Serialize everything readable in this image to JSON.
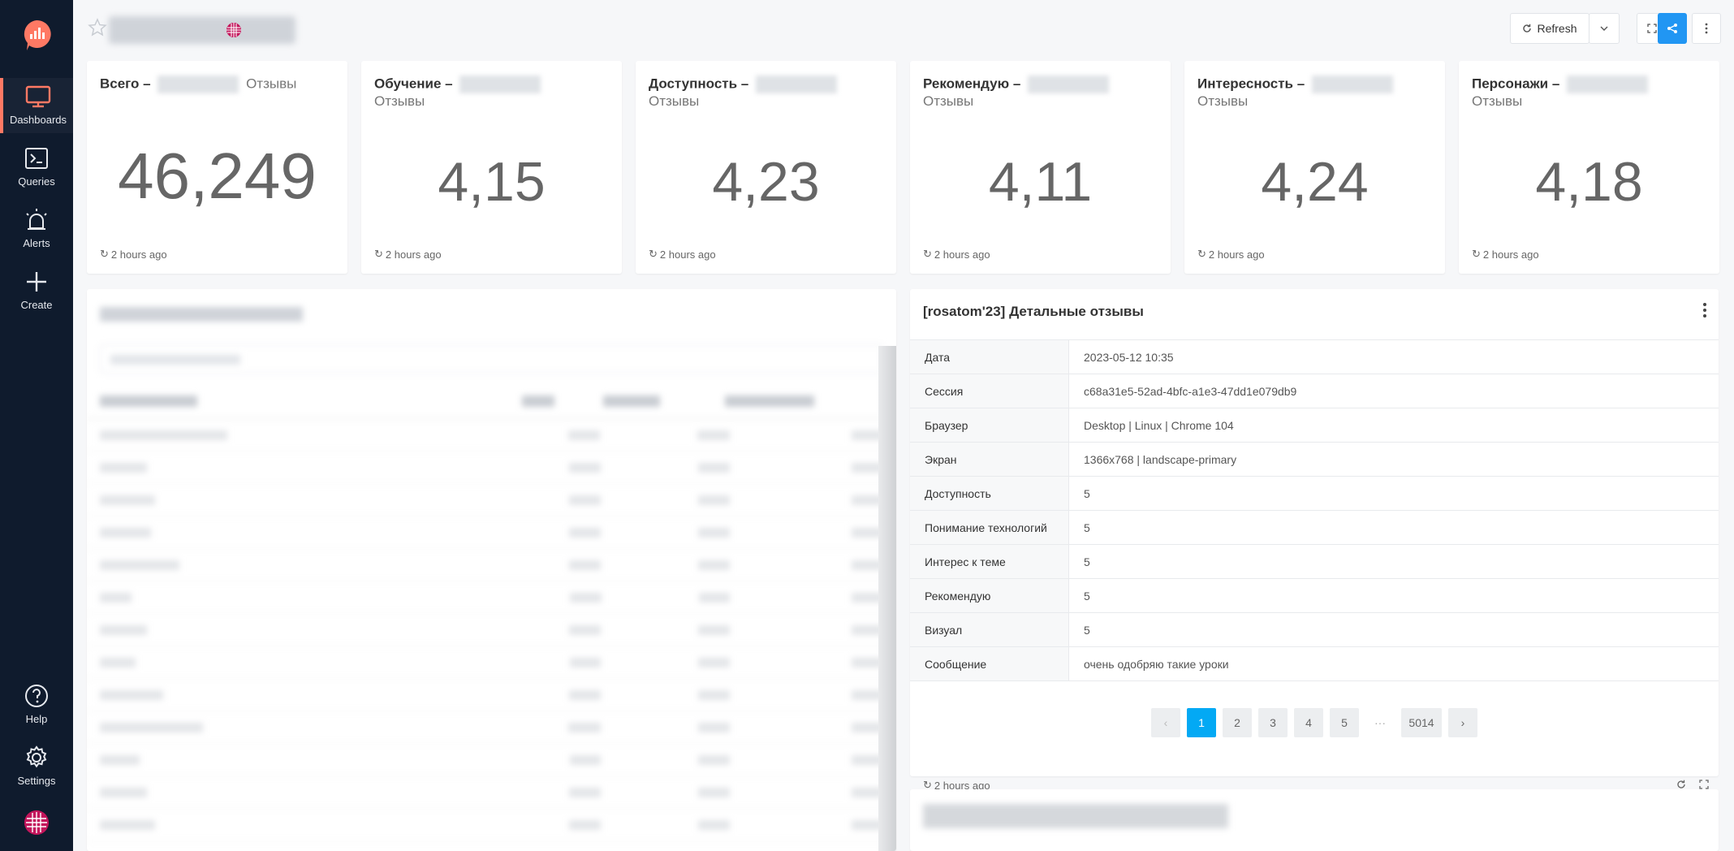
{
  "sidebar": {
    "items": [
      {
        "label": "Dashboards"
      },
      {
        "label": "Queries"
      },
      {
        "label": "Alerts"
      },
      {
        "label": "Create"
      },
      {
        "label": "Help"
      },
      {
        "label": "Settings"
      }
    ],
    "accent": "#ff7964"
  },
  "header": {
    "refresh_label": "Refresh"
  },
  "counters": [
    {
      "title": "Всего",
      "subtitle": "Отзывы",
      "value": "46,249",
      "updated": "2 hours ago"
    },
    {
      "title": "Обучение",
      "subtitle": "Отзывы",
      "value": "4,15",
      "updated": "2 hours ago"
    },
    {
      "title": "Доступность",
      "subtitle": "Отзывы",
      "value": "4,23",
      "updated": "2 hours ago"
    },
    {
      "title": "Рекомендую",
      "subtitle": "Отзывы",
      "value": "4,11",
      "updated": "2 hours ago"
    },
    {
      "title": "Интересность",
      "subtitle": "Отзывы",
      "value": "4,24",
      "updated": "2 hours ago"
    },
    {
      "title": "Персонажи",
      "subtitle": "Отзывы",
      "value": "4,18",
      "updated": "2 hours ago"
    }
  ],
  "detail": {
    "title": "[rosatom'23] Детальные отзывы",
    "rows": [
      {
        "key": "Дата",
        "value": "2023-05-12 10:35"
      },
      {
        "key": "Сессия",
        "value": "c68a31e5-52ad-4bfc-a1e3-47dd1e079db9"
      },
      {
        "key": "Браузер",
        "value": "Desktop | Linux | Chrome 104"
      },
      {
        "key": "Экран",
        "value": "1366x768 | landscape-primary"
      },
      {
        "key": "Доступность",
        "value": "5"
      },
      {
        "key": "Понимание технологий",
        "value": "5"
      },
      {
        "key": "Интерес к теме",
        "value": "5"
      },
      {
        "key": "Рекомендую",
        "value": "5"
      },
      {
        "key": "Визуал",
        "value": "5"
      },
      {
        "key": "Сообщение",
        "value": "очень одобряю такие уроки"
      }
    ],
    "pagination": {
      "prev": "‹",
      "next": "›",
      "pages": [
        "1",
        "2",
        "3",
        "4",
        "5"
      ],
      "ellipsis": "···",
      "last": "5014",
      "current": "1"
    },
    "updated": "2 hours ago"
  },
  "colors": {
    "sidebar_bg": "#0f1b2d",
    "primary": "#2196f3",
    "page_active": "#03a9f4"
  }
}
